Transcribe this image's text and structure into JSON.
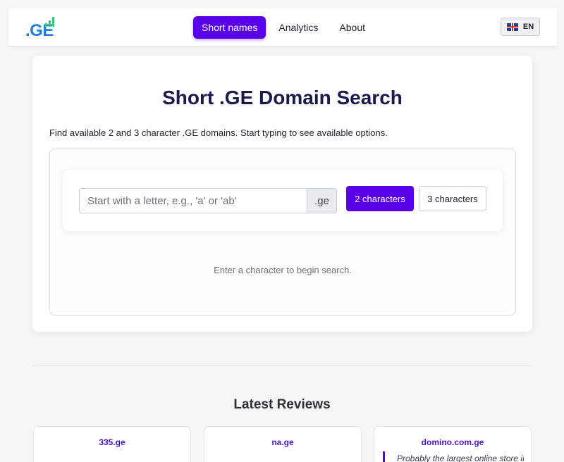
{
  "header": {
    "logo_text": ".GE",
    "logo_bar_color": "#2ecc71",
    "logo_color": "#1f7fd8",
    "nav": [
      {
        "label": "Short names",
        "active": true
      },
      {
        "label": "Analytics",
        "active": false
      },
      {
        "label": "About",
        "active": false
      }
    ],
    "language": {
      "code": "EN",
      "flag_icon": "uk-flag-icon"
    }
  },
  "main": {
    "title": "Short .GE Domain Search",
    "subtitle": "Find available 2 and 3 character .GE domains. Start typing to see available options.",
    "search": {
      "value": "",
      "placeholder": "Start with a letter, e.g., 'a' or 'ab'",
      "suffix": ".ge"
    },
    "length_options": [
      {
        "label": "2 characters",
        "selected": true
      },
      {
        "label": "3 characters",
        "selected": false
      }
    ],
    "hint": "Enter a character to begin search."
  },
  "reviews": {
    "title": "Latest Reviews",
    "items": [
      {
        "name": "335.ge",
        "quote": ""
      },
      {
        "name": "na.ge",
        "quote": ""
      },
      {
        "name": "domino.com.ge",
        "quote": "Probably the largest online store in"
      }
    ]
  },
  "colors": {
    "accent": "#5a00e8",
    "title": "#1b1a4a",
    "background": "#f5f6f5"
  }
}
